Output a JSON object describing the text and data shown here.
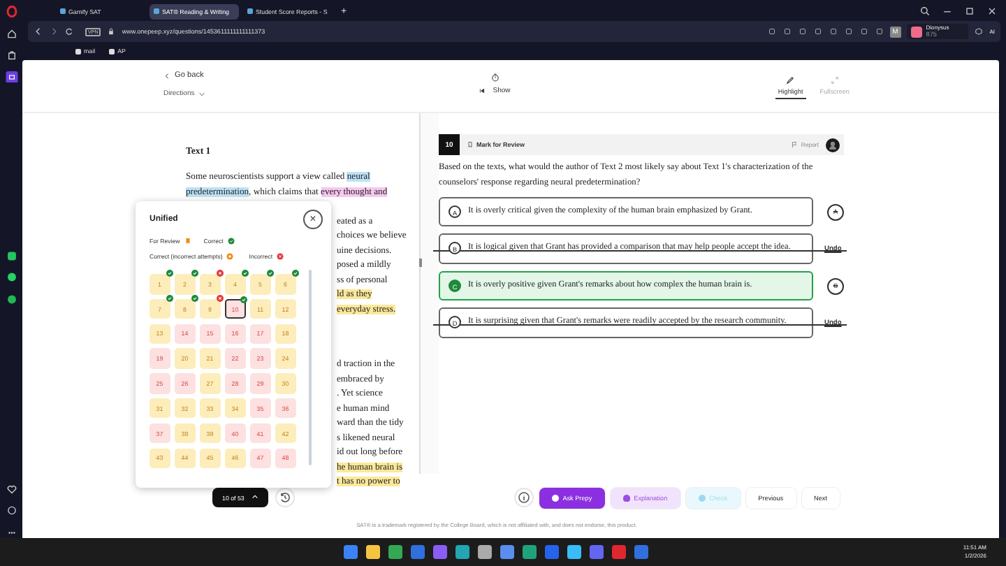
{
  "browser": {
    "tabs": [
      {
        "label": "Gamify SAT",
        "selected": false
      },
      {
        "label": "SAT® Reading & Writing",
        "selected": true
      },
      {
        "label": "Student Score Reports - S",
        "selected": false
      }
    ],
    "new_tab": "+",
    "vpn": "VPN",
    "url": "www.onepeep.xyz/questions/1453611111111111373",
    "profile": "M",
    "account": {
      "name": "Dionysus",
      "sub": "875"
    },
    "ai": "AI",
    "bookmarks": [
      "mail",
      "AP"
    ]
  },
  "toolbar": {
    "back": "Go back",
    "directions": "Directions",
    "timer": "Show",
    "tools": [
      {
        "label": "Highlight",
        "selected": true
      },
      {
        "label": "Fullscreen",
        "selected": false
      }
    ]
  },
  "passage": {
    "title": "Text 1",
    "paragraphs": [
      {
        "lines": [
          {
            "partial": false,
            "segments": [
              {
                "text": "Some neuroscientists support a view called "
              },
              {
                "text": "neural",
                "color": "#bfe1f6"
              }
            ]
          },
          {
            "partial": false,
            "segments": [
              {
                "text": "predetermination",
                "color": "#bfe1f6"
              },
              {
                "text": ", which claims that "
              },
              {
                "text": "every thought and",
                "color": "#f7c8ef"
              }
            ]
          },
          {
            "partial": true,
            "segments": [
              {
                "text": "eated as a"
              }
            ]
          },
          {
            "partial": true,
            "segments": [
              {
                "text": "choices we believe"
              }
            ]
          },
          {
            "partial": true,
            "segments": [
              {
                "text": "uine decisions."
              }
            ]
          },
          {
            "partial": true,
            "segments": [
              {
                "text": "posed a mildly"
              }
            ]
          },
          {
            "partial": true,
            "segments": [
              {
                "text": "ss of personal"
              }
            ]
          },
          {
            "partial": true,
            "segments": [
              {
                "text": "ld as they",
                "color": "#fbe89a"
              }
            ]
          },
          {
            "partial": true,
            "segments": [
              {
                "text": "everyday stress.",
                "color": "#fbe89a"
              }
            ]
          }
        ]
      },
      {
        "lines": [
          {
            "partial": true,
            "segments": [
              {
                "text": "d traction in the"
              }
            ]
          },
          {
            "partial": true,
            "segments": [
              {
                "text": "embraced by"
              }
            ]
          },
          {
            "partial": true,
            "segments": [
              {
                "text": ". Yet science"
              }
            ]
          },
          {
            "partial": true,
            "segments": [
              {
                "text": "e human mind"
              }
            ]
          },
          {
            "partial": true,
            "segments": [
              {
                "text": "ward than the tidy"
              }
            ]
          },
          {
            "partial": true,
            "segments": [
              {
                "text": "s likened neural"
              }
            ]
          },
          {
            "partial": true,
            "segments": [
              {
                "text": "id out long before"
              }
            ]
          },
          {
            "partial": true,
            "segments": [
              {
                "text": "he human brain is",
                "color": "#fbe89a"
              }
            ]
          },
          {
            "partial": true,
            "segments": [
              {
                "text": "t has no power to",
                "color": "#fbe89a"
              }
            ]
          }
        ]
      }
    ]
  },
  "navigator": {
    "title": "Unified",
    "close": "×",
    "legend": [
      {
        "label": "For Review",
        "kind": "review"
      },
      {
        "label": "Correct",
        "kind": "correct"
      },
      {
        "label": "Correct (incorrect attempts)",
        "kind": "partial"
      },
      {
        "label": "Incorrect",
        "kind": "incorrect"
      }
    ],
    "tiles": [
      {
        "number": "1",
        "color": "#fdedbb",
        "kind": "correct",
        "selected": false
      },
      {
        "number": "2",
        "color": "#fdedbb",
        "kind": "correct",
        "selected": false
      },
      {
        "number": "3",
        "color": "#fdedbb",
        "kind": "incorrect",
        "selected": false
      },
      {
        "number": "4",
        "color": "#fdedbb",
        "kind": "correct",
        "selected": false
      },
      {
        "number": "5",
        "color": "#fdedbb",
        "kind": "correct",
        "selected": false
      },
      {
        "number": "6",
        "color": "#fdedbb",
        "kind": "correct",
        "selected": false
      },
      {
        "number": "7",
        "color": "#fdedbb",
        "kind": "correct",
        "selected": false
      },
      {
        "number": "8",
        "color": "#fdedbb",
        "kind": "correct",
        "selected": false
      },
      {
        "number": "9",
        "color": "#fdedbb",
        "kind": "incorrect",
        "selected": false
      },
      {
        "number": "10",
        "color": "#fde0e0",
        "kind": "correct",
        "selected": true
      },
      {
        "number": "11",
        "color": "#fdedbb",
        "kind": "plain",
        "selected": false
      },
      {
        "number": "12",
        "color": "#fdedbb",
        "kind": "plain",
        "selected": false
      },
      {
        "number": "13",
        "color": "#fdedbb",
        "kind": "plain",
        "selected": false
      },
      {
        "number": "14",
        "color": "#fde0e0",
        "kind": "plain",
        "selected": false
      },
      {
        "number": "15",
        "color": "#fde0e0",
        "kind": "plain",
        "selected": false
      },
      {
        "number": "16",
        "color": "#fde0e0",
        "kind": "plain",
        "selected": false
      },
      {
        "number": "17",
        "color": "#fde0e0",
        "kind": "plain",
        "selected": false
      },
      {
        "number": "18",
        "color": "#fdedbb",
        "kind": "plain",
        "selected": false
      },
      {
        "number": "19",
        "color": "#fde0e0",
        "kind": "plain",
        "selected": false
      },
      {
        "number": "20",
        "color": "#fdedbb",
        "kind": "plain",
        "selected": false
      },
      {
        "number": "21",
        "color": "#fdedbb",
        "kind": "plain",
        "selected": false
      },
      {
        "number": "22",
        "color": "#fde0e0",
        "kind": "plain",
        "selected": false
      },
      {
        "number": "23",
        "color": "#fde0e0",
        "kind": "plain",
        "selected": false
      },
      {
        "number": "24",
        "color": "#fdedbb",
        "kind": "plain",
        "selected": false
      },
      {
        "number": "25",
        "color": "#fde0e0",
        "kind": "plain",
        "selected": false
      },
      {
        "number": "26",
        "color": "#fde0e0",
        "kind": "plain",
        "selected": false
      },
      {
        "number": "27",
        "color": "#fdedbb",
        "kind": "plain",
        "selected": false
      },
      {
        "number": "28",
        "color": "#fde0e0",
        "kind": "plain",
        "selected": false
      },
      {
        "number": "29",
        "color": "#fde0e0",
        "kind": "plain",
        "selected": false
      },
      {
        "number": "30",
        "color": "#fdedbb",
        "kind": "plain",
        "selected": false
      },
      {
        "number": "31",
        "color": "#fdedbb",
        "kind": "plain",
        "selected": false
      },
      {
        "number": "32",
        "color": "#fdedbb",
        "kind": "plain",
        "selected": false
      },
      {
        "number": "33",
        "color": "#fdedbb",
        "kind": "plain",
        "selected": false
      },
      {
        "number": "34",
        "color": "#fdedbb",
        "kind": "plain",
        "selected": false
      },
      {
        "number": "35",
        "color": "#fde0e0",
        "kind": "plain",
        "selected": false
      },
      {
        "number": "36",
        "color": "#fde0e0",
        "kind": "plain",
        "selected": false
      },
      {
        "number": "37",
        "color": "#fde0e0",
        "kind": "plain",
        "selected": false
      },
      {
        "number": "38",
        "color": "#fdedbb",
        "kind": "plain",
        "selected": false
      },
      {
        "number": "39",
        "color": "#fdedbb",
        "kind": "plain",
        "selected": false
      },
      {
        "number": "40",
        "color": "#fde0e0",
        "kind": "plain",
        "selected": false
      },
      {
        "number": "41",
        "color": "#fde0e0",
        "kind": "plain",
        "selected": false
      },
      {
        "number": "42",
        "color": "#fdedbb",
        "kind": "plain",
        "selected": false
      },
      {
        "number": "43",
        "color": "#fdedbb",
        "kind": "plain",
        "selected": false
      },
      {
        "number": "44",
        "color": "#fdedbb",
        "kind": "plain",
        "selected": false
      },
      {
        "number": "45",
        "color": "#fdedbb",
        "kind": "plain",
        "selected": false
      },
      {
        "number": "46",
        "color": "#fdedbb",
        "kind": "plain",
        "selected": false
      },
      {
        "number": "47",
        "color": "#fde0e0",
        "kind": "plain",
        "selected": false
      },
      {
        "number": "48",
        "color": "#fde0e0",
        "kind": "plain",
        "selected": false
      }
    ]
  },
  "question": {
    "number": "10",
    "mark": "Mark for Review",
    "report": "Report",
    "prompt": "Based on the texts, what would the author of Text 2 most likely say about Text 1's characterization of the counselors' response regarding neural predetermination?",
    "choices": [
      {
        "letter": "A",
        "text": "It is overly critical given the complexity of the human brain emphasized by Grant.",
        "selected": false,
        "eliminated": false,
        "action": "A"
      },
      {
        "letter": "B",
        "text": "It is logical given that Grant has provided a comparison that may help people accept the idea.",
        "selected": false,
        "eliminated": true,
        "action": "Undo"
      },
      {
        "letter": "C",
        "text": "It is overly positive given Grant's remarks about how complex the human brain is.",
        "selected": true,
        "eliminated": false,
        "action": "C"
      },
      {
        "letter": "D",
        "text": "It is surprising given that Grant's remarks were readily accepted by the research community.",
        "selected": false,
        "eliminated": true,
        "action": "Undo"
      }
    ]
  },
  "bottom": {
    "progress": "10 of 53",
    "buttons": [
      {
        "label": "Ask Prepy",
        "kind": "primary",
        "disabled": false
      },
      {
        "label": "Explanation",
        "kind": "soft",
        "disabled": false
      },
      {
        "label": "Check",
        "kind": "check",
        "disabled": true
      },
      {
        "label": "Previous",
        "kind": "plain",
        "disabled": false
      },
      {
        "label": "Next",
        "kind": "plain",
        "disabled": false
      }
    ]
  },
  "footer": "SAT® is a trademark registered by the College Board, which is not affiliated with, and does not endorse, this product.",
  "taskbar": {
    "time": "11:51 AM",
    "date": "1/2/2026"
  }
}
